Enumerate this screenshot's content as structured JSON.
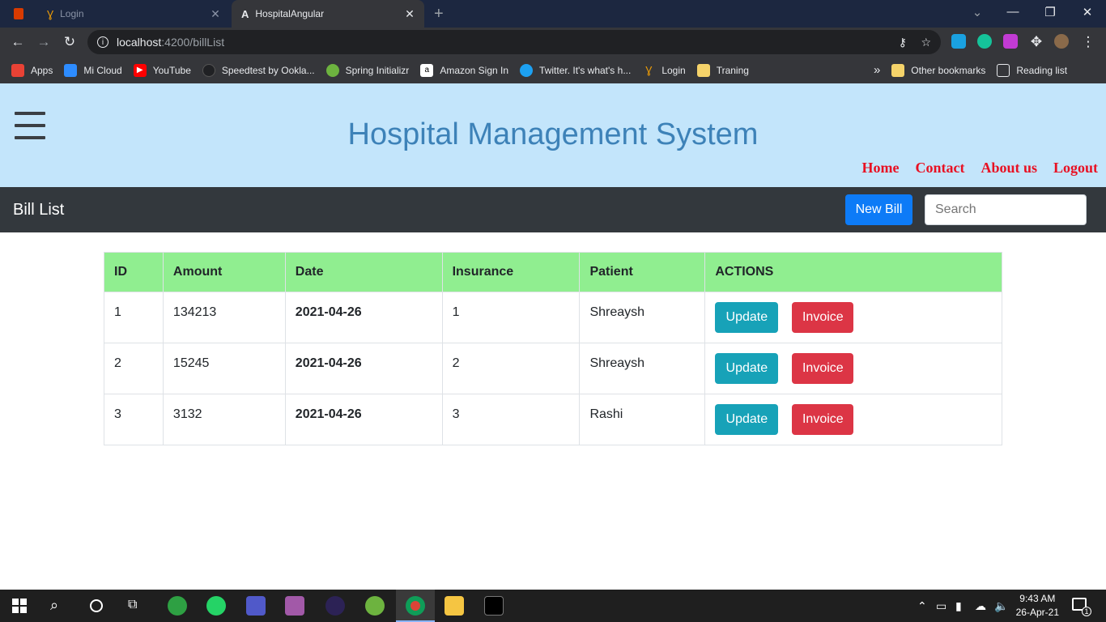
{
  "browser": {
    "tabs": [
      {
        "title": "Login"
      },
      {
        "title": "HospitalAngular"
      }
    ],
    "address": {
      "host": "localhost",
      "path": ":4200/billList"
    },
    "bookmarks": [
      "Apps",
      "Mi Cloud",
      "YouTube",
      "Speedtest by Ookla...",
      "Spring Initializr",
      "Amazon Sign In",
      "Twitter. It's what's h...",
      "Login",
      "Traning"
    ],
    "other_bookmarks": "Other bookmarks",
    "reading_list": "Reading list",
    "overflow": "»"
  },
  "header": {
    "title": "Hospital Management System",
    "nav": [
      "Home",
      "Contact",
      "About us",
      "Logout"
    ]
  },
  "subbar": {
    "title": "Bill List",
    "new_bill": "New Bill",
    "search_placeholder": "Search"
  },
  "table": {
    "columns": [
      "ID",
      "Amount",
      "Date",
      "Insurance",
      "Patient",
      "ACTIONS"
    ],
    "rows": [
      {
        "id": "1",
        "amount": "134213",
        "date": "2021-04-26",
        "insurance": "1",
        "patient": "Shreaysh"
      },
      {
        "id": "2",
        "amount": "15245",
        "date": "2021-04-26",
        "insurance": "2",
        "patient": "Shreaysh"
      },
      {
        "id": "3",
        "amount": "3132",
        "date": "2021-04-26",
        "insurance": "3",
        "patient": "Rashi"
      }
    ],
    "update_label": "Update",
    "invoice_label": "Invoice"
  },
  "taskbar": {
    "time": "9:43 AM",
    "date": "26-Apr-21",
    "notification_count": "1"
  },
  "colors": {
    "header_bg": "#c3e5fb",
    "title": "#3d82b8",
    "nav_link": "#e81123",
    "table_header": "#90ee90",
    "update": "#17a2b8",
    "invoice": "#dc3545",
    "new_bill": "#0d7bf7"
  }
}
